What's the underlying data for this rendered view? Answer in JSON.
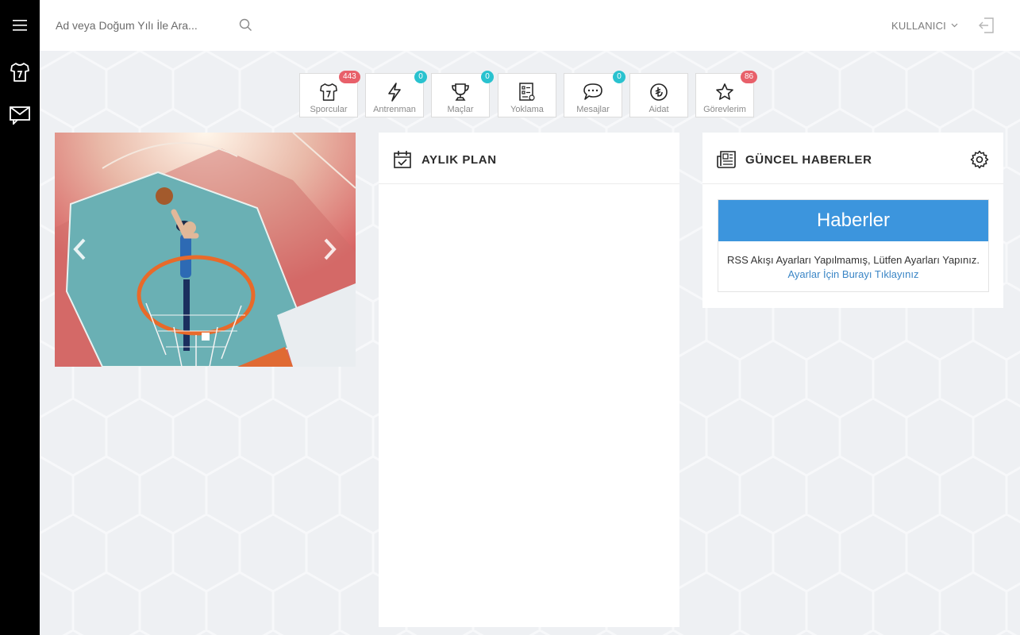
{
  "search": {
    "placeholder": "Ad veya Doğum Yılı İle Ara..."
  },
  "user": {
    "label": "KULLANICI"
  },
  "colors": {
    "sidebar": "#000000",
    "badge_red": "#e8606a",
    "badge_teal": "#29c2cf",
    "news_header": "#3c95dd",
    "link": "#3b86c6"
  },
  "sidebar": {
    "items": [
      {
        "icon": "jersey-icon"
      },
      {
        "icon": "mail-icon"
      }
    ]
  },
  "shortcuts": [
    {
      "label": "Sporcular",
      "icon": "jersey-icon",
      "badge": "443",
      "badge_color": "red"
    },
    {
      "label": "Antrenman",
      "icon": "lightning-icon",
      "badge": "0",
      "badge_color": "teal"
    },
    {
      "label": "Maçlar",
      "icon": "trophy-icon",
      "badge": "0",
      "badge_color": "teal"
    },
    {
      "label": "Yoklama",
      "icon": "checklist-icon",
      "badge": "",
      "badge_color": ""
    },
    {
      "label": "Mesajlar",
      "icon": "chat-icon",
      "badge": "0",
      "badge_color": "teal"
    },
    {
      "label": "Aidat",
      "icon": "lira-icon",
      "badge": "",
      "badge_color": ""
    },
    {
      "label": "Görevlerim",
      "icon": "star-icon",
      "badge": "86",
      "badge_color": "red"
    }
  ],
  "monthly_plan": {
    "title": "AYLIK PLAN"
  },
  "news": {
    "title": "GÜNCEL HABERLER",
    "header": "Haberler",
    "message": "RSS Akışı Ayarları Yapılmamış, Lütfen Ayarları Yapınız.",
    "link": "Ayarlar İçin Burayı Tıklayınız"
  }
}
